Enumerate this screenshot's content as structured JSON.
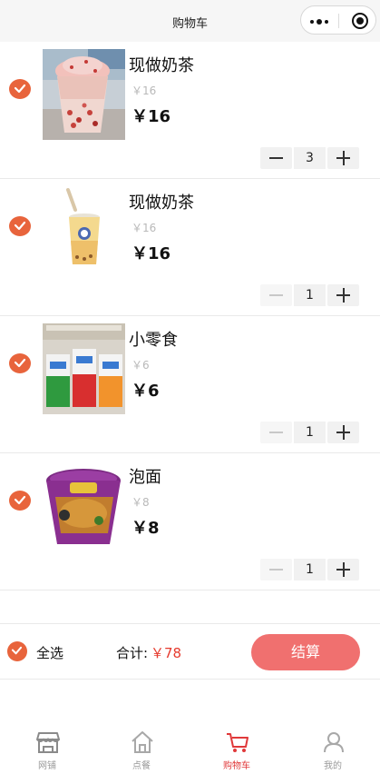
{
  "navbar": {
    "title": "购物车"
  },
  "colors": {
    "accent": "#e8643c",
    "checkout": "#f0706f",
    "price_red": "#e63b2e",
    "active_tab": "#e0393a"
  },
  "cart": {
    "items": [
      {
        "name": "现做奶茶",
        "orig_price": "￥16",
        "price": "￥16",
        "qty": "3",
        "image": "milk-tea-cup-image"
      },
      {
        "name": "现做奶茶",
        "orig_price": "￥16",
        "price": "￥16",
        "qty": "1",
        "image": "bubble-tea-cup-image"
      },
      {
        "name": "小零食",
        "orig_price": "￥6",
        "price": "￥6",
        "qty": "1",
        "image": "snack-boxes-image"
      },
      {
        "name": "泡面",
        "orig_price": "￥8",
        "price": "￥8",
        "qty": "1",
        "image": "instant-noodles-image"
      }
    ]
  },
  "footer": {
    "select_all": "全选",
    "total_label": "合计:",
    "total_value": "￥78",
    "checkout": "结算"
  },
  "tabbar": {
    "tabs": [
      {
        "label": "网铺",
        "icon": "store-icon"
      },
      {
        "label": "点餐",
        "icon": "home-icon"
      },
      {
        "label": "购物车",
        "icon": "cart-icon",
        "active": true
      },
      {
        "label": "我的",
        "icon": "user-icon"
      }
    ]
  }
}
